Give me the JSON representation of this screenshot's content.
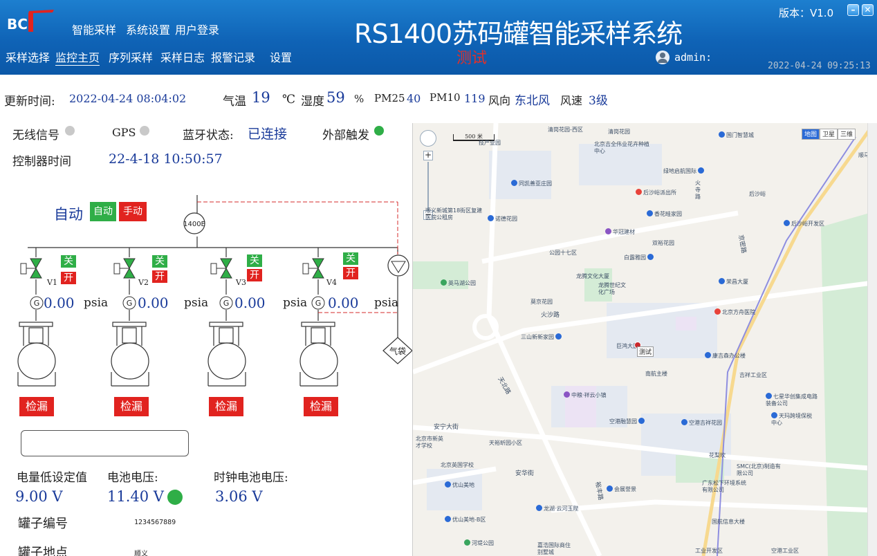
{
  "header": {
    "logo_text": "BCT",
    "top_menu": [
      "智能采样",
      "系统设置",
      "用户登录"
    ],
    "nav": [
      "采样选择",
      "监控主页",
      "序列采样",
      "采样日志",
      "报警记录",
      "设置"
    ],
    "title": "RS1400苏码罐智能采样系统",
    "subtitle": "测试",
    "version": "版本：V1.0",
    "username": "admin:",
    "datetime": "2022-04-24 09:25:13",
    "colors": {
      "bar": "#0f63b6",
      "subtitle": "#e0302a"
    }
  },
  "status": {
    "update_label": "更新时间:",
    "update_time": "2022-04-24 08:04:02",
    "temp_label": "气温",
    "temp_value": "19",
    "temp_unit": "℃",
    "humidity_label": "湿度",
    "humidity_value": "59",
    "humidity_unit": "%",
    "pm25_label": "PM25",
    "pm25_value": "40",
    "pm10_label": "PM10",
    "pm10_value": "119",
    "wind_dir_label": "风向",
    "wind_dir_value": "东北风",
    "wind_speed_label": "风速",
    "wind_speed_value": "3级"
  },
  "signals": {
    "wireless_label": "无线信号",
    "gps_label": "GPS",
    "bluetooth_label": "蓝牙状态:",
    "bluetooth_value": "已连接",
    "external_label": "外部触发",
    "controller_time_label": "控制器时间",
    "controller_time_value": "22-4-18 10:50:57"
  },
  "control": {
    "mode_label": "自动",
    "auto_button": "自动",
    "manual_button": "手动",
    "controller_model": "1400E"
  },
  "valves": [
    {
      "name": "V1",
      "close": "关",
      "open": "开",
      "gauge": "G",
      "pressure": "0.00",
      "unit": "psia",
      "leak_button": "检漏"
    },
    {
      "name": "V2",
      "close": "关",
      "open": "开",
      "gauge": "G",
      "pressure": "0.00",
      "unit": "psia",
      "leak_button": "检漏"
    },
    {
      "name": "V3",
      "close": "关",
      "open": "开",
      "gauge": "G",
      "pressure": "0.00",
      "unit": "psia",
      "leak_button": "检漏"
    },
    {
      "name": "V4",
      "close": "关",
      "open": "开",
      "gauge": "G",
      "pressure": "0.00",
      "unit": "psia",
      "leak_button": "检漏"
    }
  ],
  "air_bag_label": "气袋",
  "battery": {
    "low_setting_label": "电量低设定值",
    "low_setting_value": "9.00 V",
    "battery_voltage_label": "电池电压:",
    "battery_voltage_value": "11.40 V",
    "clock_battery_label": "时钟电池电压:",
    "clock_battery_value": "3.06 V"
  },
  "canister": {
    "number_label": "罐子编号",
    "number_value": "1234567889",
    "location_label": "罐子地点",
    "location_value": "顺义"
  },
  "map": {
    "scale": "500 米",
    "types": [
      "地图",
      "卫星",
      "三维"
    ],
    "marker": "测试",
    "roads": [
      "火沙路",
      "天北路",
      "京密路",
      "安华街",
      "安宁大街",
      "裕丰路"
    ],
    "pois": [
      "清岗花园-西区",
      "清岗花园",
      "北京吉全伟业花卉种植中心",
      "国门智慧城",
      "顺马",
      "技产业园",
      "绿地启航国际",
      "同凯善亚庄园",
      "后沙峪派出所",
      "火寺路",
      "后沙峪",
      "顺义新城第18街区复建医院公租房",
      "诺德花园",
      "香花畦家园",
      "华冠建材",
      "后沙峪开发区",
      "双裕花园",
      "公园十七区",
      "白露雅园",
      "英马湖公园",
      "龙腾文化大厦",
      "龙腾世纪文化广场",
      "荣昌大厦",
      "莫京花园",
      "北京方舟医院",
      "三山新新家园",
      "巨鸿大厦",
      "康吉森办公楼",
      "南航主楼",
      "吉祥工业区",
      "中粮·祥云小镇",
      "七星华创集成电路装备公司",
      "空港融慧园",
      "空港吉祥花园",
      "天玛跨境保税中心",
      "天裕昕园小区",
      "北京市新英才学校",
      "花梨坎",
      "北京英国学校",
      "SMC(北京)制造有限公司",
      "优山美地",
      "会展誉景",
      "广东松下环境系统有限公司",
      "龙湖·云河玉陛",
      "优山美地-B区",
      "国航信息大楼",
      "河堤公园",
      "嘉浩国际商住别墅城",
      "工业开发区",
      "空港工业区"
    ]
  }
}
